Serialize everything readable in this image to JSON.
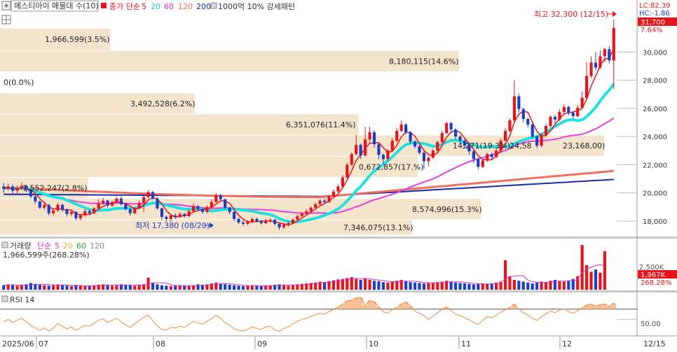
{
  "header": {
    "title": "메스티아이 매물대 수(10)",
    "ma_prefix": "종가 단순",
    "ma_periods": [
      "5",
      "20",
      "60",
      "120",
      "200"
    ],
    "extra": "1000억 10% 강세패턴"
  },
  "right_axis": {
    "lc": "LC:82.39",
    "hc": "HC:-1.86",
    "current_price": "31,700",
    "current_change": "7.64%",
    "price_ticks": [
      "30,000",
      "28,000",
      "26,000",
      "24,000",
      "22,000",
      "20,000",
      "18,000"
    ]
  },
  "annotations": {
    "high": "최고 32,300 (12/15)",
    "low": "최저 17,380 (08/20)"
  },
  "volume_panel": {
    "title": "거래량",
    "ma_prefix": "단순",
    "ma_periods": [
      "5",
      "20",
      "60",
      "120"
    ],
    "info": "1,966,599주(268.28%)",
    "tick": "2,500K",
    "current": "1,967K",
    "pct": "268.28%"
  },
  "rsi_panel": {
    "title": "RSI 14",
    "tick": "50.00"
  },
  "x_axis": {
    "labels": [
      "2025/06",
      "07",
      "08",
      "09",
      "10",
      "11",
      "12",
      "12/15"
    ]
  },
  "colors": {
    "up": "#e8141c",
    "down": "#1c3fc4",
    "ma5": "#e8141c",
    "ma20": "#1fe0e0",
    "ma60": "#e040e0",
    "ma120": "#f07060",
    "ma200": "#1a2aa0",
    "profile": "#f5e4cc",
    "rsi": "#f08a40"
  },
  "chart_data": {
    "type": "candlestick",
    "y_axis": {
      "min": 17000,
      "max": 32800
    },
    "volume_profile": [
      {
        "label": "1,966,599(3.5%)",
        "price_from": 30100,
        "price_to": 31700
      },
      {
        "label": "8,180,115(14.6%)",
        "price_from": 28600,
        "price_to": 30100
      },
      {
        "label": "0(0.0%)",
        "price_from": 27100,
        "price_to": 28600
      },
      {
        "label": "3,492,528(6.2%)",
        "price_from": 25600,
        "price_to": 27100
      },
      {
        "label": "6,351,076(11.4%)",
        "price_from": 24100,
        "price_to": 25600
      },
      {
        "label": "14,271(19.3%)",
        "price_from": 22600,
        "price_to": 24100
      },
      {
        "label": "24,58",
        "price_from": 22600,
        "price_to": 24100
      },
      {
        "label": "23,168,00)",
        "price_from": 22600,
        "price_to": 24100
      },
      {
        "label": "0,672,857(17.%)",
        "price_from": 21100,
        "price_to": 22600
      },
      {
        "label": "1,552,247(2.8%)",
        "price_from": 19600,
        "price_to": 21100
      },
      {
        "label": "8,574,996(15.3%)",
        "price_from": 18100,
        "price_to": 19600
      },
      {
        "label": "7,346,075(13.1%)",
        "price_from": 17000,
        "price_to": 18100
      }
    ],
    "candles": [
      [
        20450,
        20300,
        20700,
        20000
      ],
      [
        20300,
        20450,
        20650,
        20150
      ],
      [
        20450,
        20150,
        20600,
        19900
      ],
      [
        20150,
        20300,
        20500,
        19950
      ],
      [
        20300,
        20500,
        20750,
        20200
      ],
      [
        20500,
        20250,
        20600,
        20050
      ],
      [
        20250,
        19750,
        20300,
        19600
      ],
      [
        19750,
        19400,
        19850,
        19200
      ],
      [
        19400,
        18950,
        19450,
        18850
      ],
      [
        18950,
        19150,
        19300,
        18800
      ],
      [
        19150,
        18550,
        19200,
        18400
      ],
      [
        18550,
        18750,
        18900,
        18400
      ],
      [
        18750,
        19150,
        19300,
        18650
      ],
      [
        19150,
        18800,
        19250,
        18650
      ],
      [
        18800,
        18500,
        18900,
        18350
      ],
      [
        18500,
        18650,
        18750,
        18350
      ],
      [
        18650,
        18200,
        18700,
        18050
      ],
      [
        18200,
        18400,
        18500,
        18050
      ],
      [
        18400,
        18700,
        18850,
        18300
      ],
      [
        18700,
        18550,
        18800,
        18450
      ],
      [
        18550,
        18900,
        19000,
        18500
      ],
      [
        18900,
        19250,
        19550,
        18800
      ],
      [
        19250,
        19450,
        19650,
        19150
      ],
      [
        19450,
        19100,
        19500,
        18950
      ],
      [
        19100,
        19350,
        19450,
        19000
      ],
      [
        19350,
        19600,
        19700,
        19250
      ],
      [
        19600,
        19200,
        19750,
        19100
      ],
      [
        19200,
        18850,
        19250,
        18750
      ],
      [
        18850,
        18550,
        18900,
        18400
      ],
      [
        18550,
        18900,
        19000,
        18500
      ],
      [
        18900,
        19300,
        19450,
        18850
      ],
      [
        19300,
        19700,
        19800,
        18650
      ],
      [
        19700,
        20050,
        20200,
        19600
      ],
      [
        20050,
        19600,
        20150,
        19500
      ],
      [
        19600,
        18900,
        19700,
        18800
      ],
      [
        18900,
        18300,
        18950,
        18100
      ],
      [
        18300,
        18150,
        18400,
        17950
      ],
      [
        18150,
        18400,
        18500,
        17950
      ],
      [
        18400,
        18300,
        18550,
        18150
      ],
      [
        18300,
        18500,
        18650,
        18200
      ],
      [
        18500,
        18350,
        18600,
        18250
      ],
      [
        18350,
        18700,
        18800,
        18300
      ],
      [
        18700,
        19050,
        19250,
        18600
      ],
      [
        19050,
        18850,
        19150,
        18750
      ],
      [
        18850,
        18650,
        18900,
        18500
      ],
      [
        18650,
        19000,
        19100,
        18550
      ],
      [
        19000,
        19350,
        19550,
        18900
      ],
      [
        19350,
        19850,
        20000,
        19300
      ],
      [
        19850,
        19550,
        19900,
        19450
      ],
      [
        19550,
        18950,
        19600,
        18850
      ],
      [
        18950,
        18650,
        19000,
        18500
      ],
      [
        18650,
        18150,
        18700,
        18000
      ],
      [
        18150,
        17900,
        18250,
        17800
      ],
      [
        17900,
        17800,
        18050,
        17650
      ],
      [
        17800,
        17950,
        18050,
        17700
      ],
      [
        17950,
        18150,
        18250,
        17850
      ],
      [
        18150,
        18000,
        18250,
        17900
      ],
      [
        18000,
        17850,
        18100,
        17750
      ],
      [
        17850,
        18050,
        18150,
        17780
      ],
      [
        18050,
        18100,
        18200,
        17900
      ],
      [
        18100,
        17800,
        18150,
        17700
      ],
      [
        17800,
        17550,
        17850,
        17380
      ],
      [
        17550,
        17750,
        17850,
        17450
      ],
      [
        17750,
        17850,
        17950,
        17600
      ],
      [
        17850,
        18100,
        18200,
        17800
      ],
      [
        18100,
        18350,
        18450,
        18000
      ],
      [
        18350,
        18550,
        18650,
        18250
      ],
      [
        18550,
        18700,
        18850,
        18450
      ],
      [
        18700,
        18950,
        19050,
        18600
      ],
      [
        18950,
        19200,
        19300,
        18850
      ],
      [
        19200,
        19450,
        19550,
        19100
      ],
      [
        19450,
        19350,
        19600,
        19250
      ],
      [
        19350,
        19750,
        19850,
        19300
      ],
      [
        19750,
        20100,
        20250,
        19700
      ],
      [
        20100,
        20450,
        20600,
        20000
      ],
      [
        20450,
        21100,
        21250,
        20350
      ],
      [
        21100,
        22000,
        22150,
        21000
      ],
      [
        22000,
        22750,
        22850,
        21900
      ],
      [
        22750,
        23400,
        24100,
        22650
      ],
      [
        23400,
        22650,
        23500,
        22400
      ],
      [
        22650,
        23800,
        24700,
        22600
      ],
      [
        23800,
        24300,
        24700,
        23650
      ],
      [
        24300,
        23450,
        24450,
        23200
      ],
      [
        23450,
        22700,
        23550,
        22400
      ],
      [
        22700,
        22400,
        22800,
        22050
      ],
      [
        22400,
        23000,
        23100,
        22250
      ],
      [
        23000,
        23700,
        23900,
        22900
      ],
      [
        23700,
        24400,
        24600,
        23600
      ],
      [
        24400,
        24850,
        25150,
        24300
      ],
      [
        24850,
        24300,
        24950,
        24150
      ],
      [
        24300,
        23650,
        24400,
        23500
      ],
      [
        23650,
        23300,
        23750,
        23150
      ],
      [
        23300,
        22850,
        23400,
        22750
      ],
      [
        22850,
        22250,
        22950,
        21700
      ],
      [
        22250,
        22500,
        22600,
        21900
      ],
      [
        22500,
        23000,
        23100,
        22400
      ],
      [
        23000,
        23600,
        23700,
        22900
      ],
      [
        23600,
        24250,
        24400,
        23500
      ],
      [
        24250,
        24950,
        25050,
        24150
      ],
      [
        24950,
        24500,
        25050,
        24250
      ],
      [
        24500,
        24000,
        24600,
        23800
      ],
      [
        24000,
        23700,
        24100,
        23500
      ],
      [
        23700,
        23350,
        23800,
        23150
      ],
      [
        23350,
        22950,
        23450,
        22700
      ],
      [
        22950,
        22400,
        23050,
        22100
      ],
      [
        22400,
        21850,
        22500,
        21700
      ],
      [
        21850,
        22300,
        22400,
        21750
      ],
      [
        22300,
        22750,
        22850,
        22200
      ],
      [
        22750,
        22550,
        22850,
        22400
      ],
      [
        22550,
        23000,
        23200,
        22450
      ],
      [
        23000,
        23700,
        23850,
        22900
      ],
      [
        23700,
        24400,
        24600,
        23650
      ],
      [
        24400,
        25150,
        25300,
        24300
      ],
      [
        25150,
        26850,
        28000,
        25050
      ],
      [
        26850,
        25950,
        27050,
        25700
      ],
      [
        25950,
        25250,
        26050,
        25000
      ],
      [
        25250,
        24850,
        25350,
        24650
      ],
      [
        24850,
        24000,
        24950,
        23900
      ],
      [
        24000,
        23350,
        24100,
        23200
      ],
      [
        23350,
        24100,
        24250,
        23250
      ],
      [
        24100,
        24750,
        24900,
        24000
      ],
      [
        24750,
        25400,
        25500,
        24650
      ],
      [
        25400,
        25200,
        25550,
        24950
      ],
      [
        25200,
        25750,
        25950,
        25100
      ],
      [
        25750,
        26100,
        26300,
        25600
      ],
      [
        26100,
        25700,
        26200,
        25500
      ],
      [
        25700,
        25450,
        25800,
        25300
      ],
      [
        25450,
        26050,
        26250,
        25350
      ],
      [
        26050,
        26750,
        27200,
        25950
      ],
      [
        26750,
        28300,
        29300,
        26650
      ],
      [
        28300,
        29250,
        29700,
        28150
      ],
      [
        29250,
        28900,
        30000,
        28700
      ],
      [
        28900,
        29700,
        30100,
        28800
      ],
      [
        29700,
        30200,
        30300,
        29300
      ],
      [
        30200,
        29400,
        30400,
        29200
      ],
      [
        29400,
        31700,
        32300,
        27400
      ]
    ],
    "volume": [
      0.1,
      0.12,
      0.11,
      0.09,
      0.1,
      0.12,
      0.15,
      0.13,
      0.11,
      0.1,
      0.09,
      0.1,
      0.12,
      0.11,
      0.09,
      0.08,
      0.1,
      0.09,
      0.08,
      0.09,
      0.1,
      0.11,
      0.12,
      0.1,
      0.09,
      0.1,
      0.12,
      0.11,
      0.1,
      0.09,
      0.1,
      0.12,
      0.27,
      0.16,
      0.12,
      0.1,
      0.09,
      0.08,
      0.09,
      0.1,
      0.09,
      0.08,
      0.1,
      0.12,
      0.11,
      0.12,
      0.14,
      0.16,
      0.13,
      0.12,
      0.11,
      0.1,
      0.09,
      0.08,
      0.09,
      0.1,
      0.09,
      0.08,
      0.09,
      0.1,
      0.11,
      0.12,
      0.1,
      0.09,
      0.1,
      0.12,
      0.13,
      0.14,
      0.15,
      0.16,
      0.18,
      0.17,
      0.19,
      0.21,
      0.23,
      0.24,
      0.26,
      0.28,
      0.24,
      0.22,
      0.25,
      0.22,
      0.2,
      0.19,
      0.17,
      0.16,
      0.18,
      0.2,
      0.22,
      0.19,
      0.17,
      0.16,
      0.15,
      0.14,
      0.15,
      0.16,
      0.17,
      0.18,
      0.2,
      0.18,
      0.16,
      0.15,
      0.14,
      0.13,
      0.12,
      0.13,
      0.14,
      0.13,
      0.14,
      0.16,
      0.18,
      0.66,
      0.3,
      0.22,
      0.2,
      0.18,
      0.16,
      0.14,
      0.16,
      0.18,
      0.17,
      0.2,
      0.22,
      0.19,
      0.18,
      0.2,
      0.24,
      0.3,
      1.0,
      0.55,
      0.4,
      0.45,
      0.38,
      0.86
    ],
    "rsi": [
      45,
      50,
      44,
      48,
      52,
      45,
      38,
      33,
      28,
      33,
      27,
      33,
      42,
      36,
      31,
      35,
      28,
      33,
      38,
      36,
      42,
      48,
      51,
      44,
      48,
      52,
      45,
      39,
      34,
      41,
      48,
      54,
      58,
      47,
      37,
      30,
      29,
      34,
      33,
      36,
      34,
      40,
      46,
      43,
      40,
      46,
      51,
      58,
      52,
      43,
      38,
      31,
      28,
      27,
      30,
      35,
      32,
      30,
      35,
      36,
      30,
      26,
      32,
      35,
      41,
      46,
      50,
      52,
      56,
      59,
      62,
      60,
      65,
      70,
      74,
      80,
      86,
      88,
      92,
      93,
      78,
      87,
      85,
      74,
      65,
      62,
      70,
      73,
      80,
      84,
      76,
      66,
      62,
      57,
      50,
      56,
      63,
      70,
      74,
      67,
      60,
      57,
      53,
      49,
      44,
      40,
      48,
      55,
      53,
      58,
      64,
      69,
      73,
      80,
      70,
      63,
      58,
      52,
      48,
      55,
      61,
      66,
      63,
      68,
      71,
      65,
      62,
      67,
      72,
      78,
      80,
      76,
      79,
      80,
      75,
      82
    ]
  }
}
